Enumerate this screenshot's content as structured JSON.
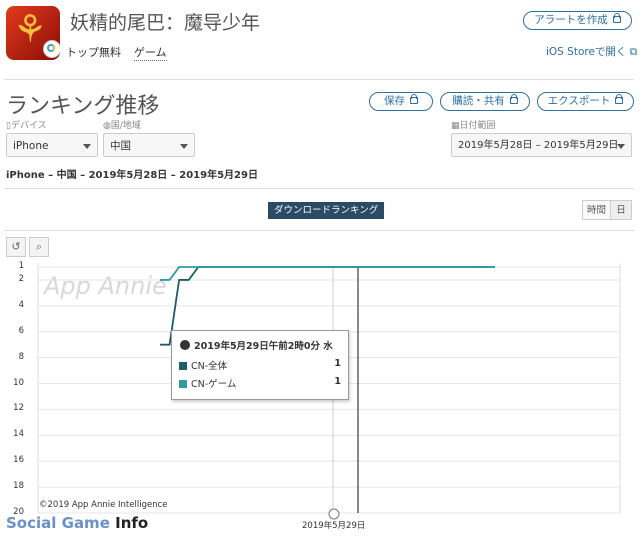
{
  "app": {
    "title": "妖精的尾巴：魔导少年",
    "price": "トップ無料",
    "category": "ゲーム"
  },
  "header_actions": {
    "alert_label": "アラートを作成",
    "store_link": "iOS Storeで開く"
  },
  "section": {
    "title": "ランキング推移",
    "save_label": "保存",
    "subscribe_label": "購読・共有",
    "export_label": "エクスポート"
  },
  "filters": {
    "device_label": "デバイス",
    "device_value": "iPhone",
    "country_label": "国/地域",
    "country_value": "中国",
    "date_label": "日付範囲",
    "date_value": "2019年5月28日 – 2019年5月29日"
  },
  "subtitle": "iPhone – 中国 – 2019年5月28日 – 2019年5月29日",
  "chart_controls": {
    "ranking_tag": "ダウンロードランキング",
    "hour_label": "時間",
    "day_label": "日"
  },
  "colors": {
    "series_total": "#1f5e66",
    "series_game": "#2f9aa0",
    "brand_blue": "#2e6ea1"
  },
  "chart_data": {
    "type": "line",
    "title": "",
    "ylabel": "",
    "y_inverted": true,
    "ylim": [
      1,
      20
    ],
    "yticks": [
      "1",
      "2",
      "4",
      "6",
      "8",
      "10",
      "12",
      "14",
      "16",
      "18",
      "20"
    ],
    "x_tick_label": "2019年5月29日",
    "grid": true,
    "series": [
      {
        "name": "CN-全体",
        "color": "#1f5e66",
        "points": [
          [
            0,
            7
          ],
          [
            1,
            7
          ],
          [
            2,
            2
          ],
          [
            3,
            2
          ],
          [
            4,
            1
          ],
          [
            5,
            1
          ],
          [
            6,
            1
          ],
          [
            7,
            1
          ],
          [
            8,
            1
          ],
          [
            9,
            1
          ],
          [
            10,
            1
          ],
          [
            11,
            1
          ],
          [
            12,
            1
          ],
          [
            13,
            1
          ],
          [
            14,
            1
          ],
          [
            15,
            1
          ],
          [
            16,
            1
          ],
          [
            17,
            1
          ],
          [
            18,
            1
          ],
          [
            19,
            1
          ],
          [
            20,
            1
          ],
          [
            21,
            1
          ],
          [
            22,
            1
          ],
          [
            23,
            1
          ],
          [
            24,
            1
          ],
          [
            25,
            1
          ],
          [
            26,
            1
          ],
          [
            27,
            1
          ],
          [
            28,
            1
          ],
          [
            29,
            1
          ],
          [
            30,
            1
          ],
          [
            31,
            1
          ],
          [
            32,
            1
          ],
          [
            33,
            1
          ],
          [
            34,
            1
          ],
          [
            35,
            1
          ]
        ]
      },
      {
        "name": "CN-ゲーム",
        "color": "#2f9aa0",
        "points": [
          [
            0,
            2
          ],
          [
            1,
            2
          ],
          [
            2,
            1
          ],
          [
            3,
            1
          ],
          [
            4,
            1
          ],
          [
            5,
            1
          ],
          [
            6,
            1
          ],
          [
            7,
            1
          ],
          [
            8,
            1
          ],
          [
            9,
            1
          ],
          [
            10,
            1
          ],
          [
            11,
            1
          ],
          [
            12,
            1
          ],
          [
            13,
            1
          ],
          [
            14,
            1
          ],
          [
            15,
            1
          ],
          [
            16,
            1
          ],
          [
            17,
            1
          ],
          [
            18,
            1
          ],
          [
            19,
            1
          ],
          [
            20,
            1
          ],
          [
            21,
            1
          ],
          [
            22,
            1
          ],
          [
            23,
            1
          ],
          [
            24,
            1
          ],
          [
            25,
            1
          ],
          [
            26,
            1
          ],
          [
            27,
            1
          ],
          [
            28,
            1
          ],
          [
            29,
            1
          ],
          [
            30,
            1
          ],
          [
            31,
            1
          ],
          [
            32,
            1
          ],
          [
            33,
            1
          ],
          [
            34,
            1
          ],
          [
            35,
            1
          ]
        ]
      }
    ],
    "tooltip": {
      "timestamp": "2019年5月29日午前2時0分 水",
      "rows": [
        {
          "name": "CN-全体",
          "value": "1"
        },
        {
          "name": "CN-ゲーム",
          "value": "1"
        }
      ]
    },
    "watermark": "App Annie",
    "copyright": "©2019 App Annie Intelligence"
  },
  "footer": {
    "brand_part1": "Social Game",
    "brand_part2": "Info"
  }
}
